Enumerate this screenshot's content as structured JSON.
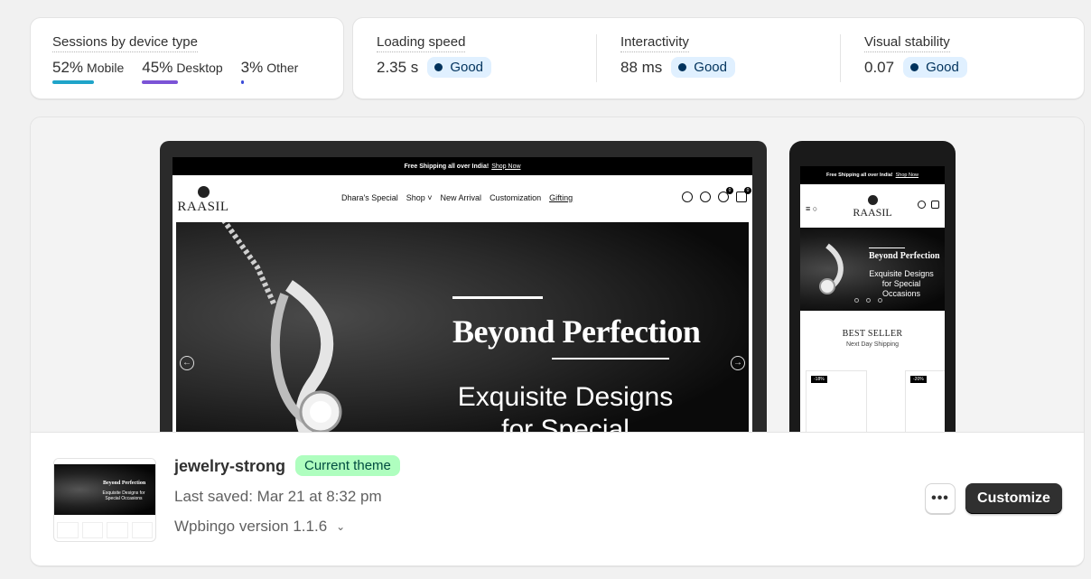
{
  "sessions": {
    "title": "Sessions by device type",
    "devices": [
      {
        "percent": "52%",
        "label": "Mobile",
        "share": 0.52,
        "color": "#1fa4c9"
      },
      {
        "percent": "45%",
        "label": "Desktop",
        "share": 0.45,
        "color": "#7b53d6"
      },
      {
        "percent": "3%",
        "label": "Other",
        "share": 0.03,
        "color": "#3b4bd8"
      }
    ]
  },
  "vitals": [
    {
      "title": "Loading speed",
      "value": "2.35 s",
      "status": "Good"
    },
    {
      "title": "Interactivity",
      "value": "88 ms",
      "status": "Good"
    },
    {
      "title": "Visual stability",
      "value": "0.07",
      "status": "Good"
    }
  ],
  "preview": {
    "announcement": "Free Shipping all over India!",
    "announcement_link": "Shop Now",
    "brand": "RAASIL",
    "nav": [
      "Dhara's Special",
      "Shop",
      "New Arrival",
      "Customization",
      "Gifting"
    ],
    "cart_count": "0",
    "wishlist_count": "0",
    "hero_title": "Beyond Perfection",
    "hero_subtitle": "Exquisite Designs for Special Occasions",
    "best_seller_title": "BEST SELLER",
    "best_seller_sub": "Next Day Shipping",
    "discount_tags": [
      "-18%",
      "-20%"
    ]
  },
  "theme": {
    "name": "jewelry-strong",
    "badge": "Current theme",
    "last_saved": "Last saved: Mar 21 at 8:32 pm",
    "version": "Wpbingo version 1.1.6",
    "more_label": "•••",
    "customize_label": "Customize"
  }
}
